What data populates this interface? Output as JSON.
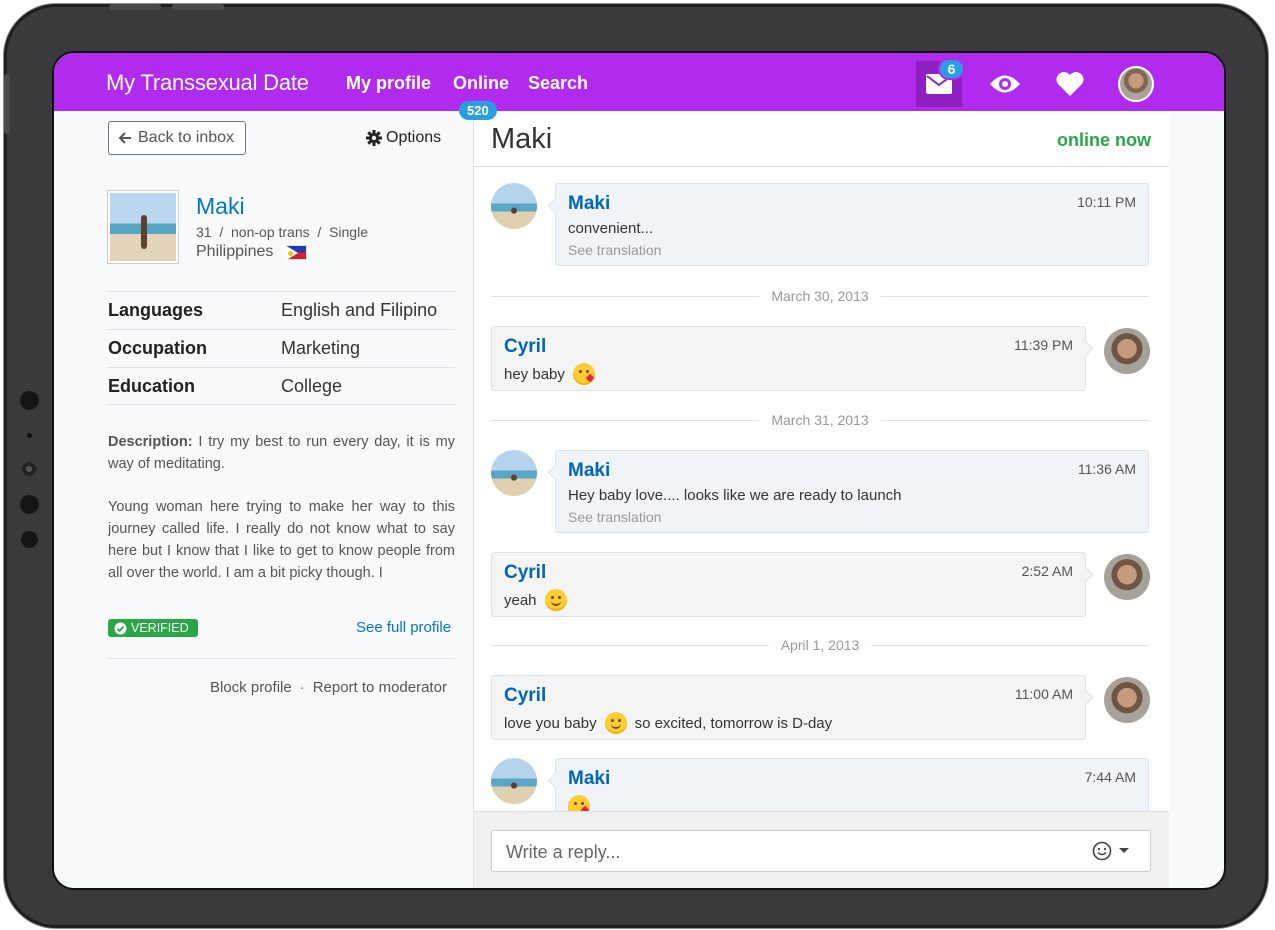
{
  "navbar": {
    "brand": "My Transsexual Date",
    "links": [
      "My profile",
      "Online",
      "Search"
    ],
    "online_count": "520",
    "mail_badge": "6"
  },
  "left_panel": {
    "back_label": "Back to inbox",
    "options_label": "Options",
    "profile": {
      "name": "Maki",
      "meta": "31  /  non-op trans  /  Single",
      "country": "Philippines"
    },
    "info": [
      {
        "label": "Languages",
        "value": "English and Filipino"
      },
      {
        "label": "Occupation",
        "value": "Marketing"
      },
      {
        "label": "Education",
        "value": "College"
      }
    ],
    "description_label": "Description:",
    "description_1": "I try my best to run every day, it is my way of meditating.",
    "description_2": "Young woman here trying to make her way to this journey called life. I really do not know what to say here but I know that I like to get to know people from all over the world. I am a bit picky though. I",
    "verified_label": "VERIFIED",
    "full_profile_label": "See full profile",
    "block_label": "Block profile",
    "separator": "·",
    "report_label": "Report to moderator"
  },
  "chat": {
    "title": "Maki",
    "status": "online now",
    "messages": [
      {
        "sender": "Maki",
        "time": "10:11 PM",
        "text": "convenient...",
        "translation": "See translation"
      },
      {
        "sender": "Cyril",
        "time": "11:39 PM",
        "text": "hey baby"
      },
      {
        "sender": "Maki",
        "time": "11:36 AM",
        "text": "Hey baby love.... looks like we are ready to launch",
        "translation": "See translation"
      },
      {
        "sender": "Cyril",
        "time": "2:52 AM",
        "text": "yeah"
      },
      {
        "sender": "Cyril",
        "time": "11:00 AM",
        "text": "love you baby",
        "text_after": "so excited, tomorrow is D-day"
      },
      {
        "sender": "Maki",
        "time": "7:44 AM"
      }
    ],
    "dates": [
      "March 30, 2013",
      "March 31, 2013",
      "April 1, 2013"
    ],
    "reply_placeholder": "Write a reply..."
  },
  "colors": {
    "navbar": "#b12bef",
    "link": "#0077cc",
    "online": "#28a745",
    "badge": "#28a0e0"
  }
}
